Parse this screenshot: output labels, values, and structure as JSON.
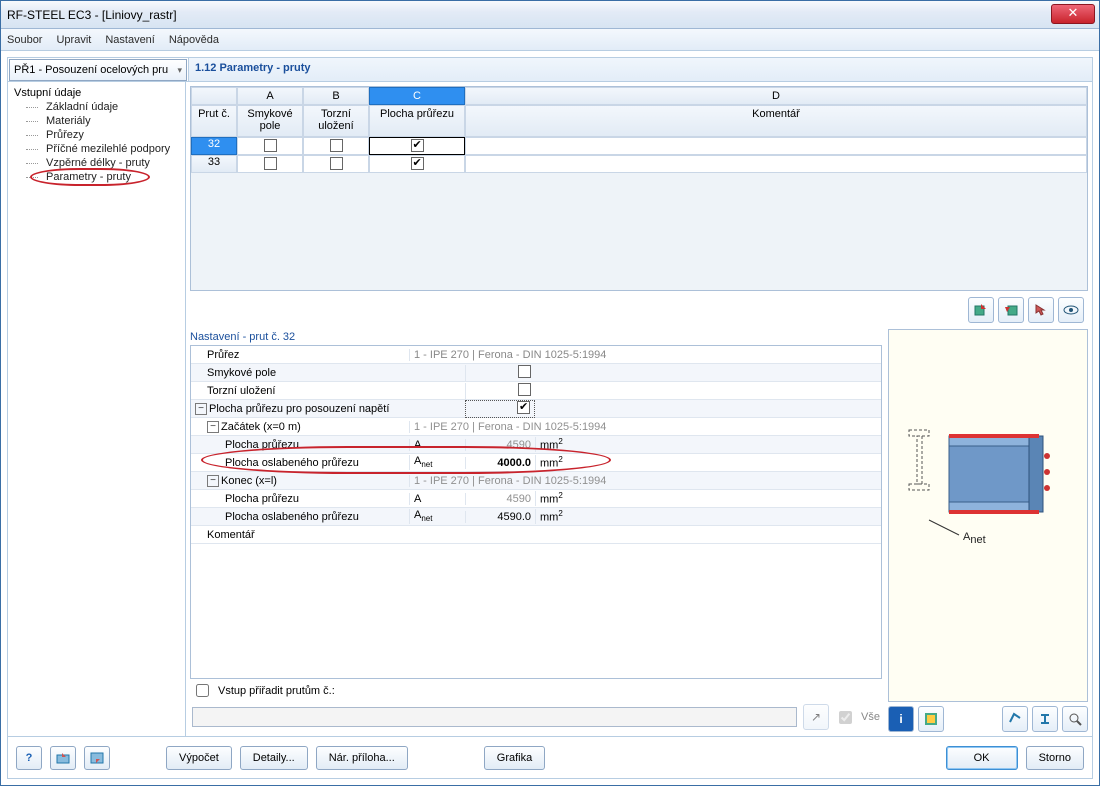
{
  "window": {
    "title": "RF-STEEL EC3 - [Liniovy_rastr]"
  },
  "menu": {
    "file": "Soubor",
    "edit": "Upravit",
    "settings": "Nastavení",
    "help": "Nápověda"
  },
  "combo": {
    "value": "PŘ1 - Posouzení ocelových pru"
  },
  "page_heading": "1.12 Parametry - pruty",
  "tree": {
    "root": "Vstupní údaje",
    "items": [
      "Základní údaje",
      "Materiály",
      "Průřezy",
      "Příčné mezilehlé podpory",
      "Vzpěrné délky - pruty",
      "Parametry - pruty"
    ]
  },
  "grid": {
    "letters": [
      "A",
      "B",
      "C",
      "D"
    ],
    "headers": {
      "rownum": "Prut č.",
      "a": "Smykové pole",
      "b": "Torzní uložení",
      "c": "Plocha průřezu",
      "d": "Komentář"
    },
    "rows": [
      {
        "num": "32",
        "a": false,
        "b": false,
        "c": true,
        "selected": true
      },
      {
        "num": "33",
        "a": false,
        "b": false,
        "c": true,
        "selected": false
      }
    ]
  },
  "toolbar_icons": {
    "i1": "import-icon",
    "i2": "export-icon",
    "i3": "pick-icon",
    "i4": "view-icon"
  },
  "settings": {
    "title": "Nastavení - prut č. 32",
    "section_desc": "1 - IPE 270 | Ferona - DIN 1025-5:1994",
    "rows": {
      "prurez": "Průřez",
      "smykove": "Smykové pole",
      "torzni": "Torzní uložení",
      "plocha_pos": "Plocha průřezu pro posouzení napětí",
      "zacatek": "Začátek (x=0 m)",
      "plocha1": "Plocha průřezu",
      "plocha_osl1": "Plocha oslabeného průřezu",
      "konec": "Konec (x=l)",
      "plocha2": "Plocha průřezu",
      "plocha_osl2": "Plocha oslabeného průřezu",
      "komentar": "Komentář"
    },
    "sym": {
      "A": "A",
      "Anet": "A",
      "Anet_sub": "net"
    },
    "vals": {
      "a1": "4590",
      "anet1": "4000.0",
      "a2": "4590",
      "anet2": "4590.0"
    },
    "unit": "mm",
    "unit_sup": "2"
  },
  "assign": {
    "label": "Vstup přiřadit prutům č.:",
    "all": "Vše"
  },
  "preview_label": "A",
  "preview_sub": "net",
  "preview_tool_icons": {
    "info": "info-icon",
    "layers": "layers-icon",
    "cs1": "cs-icon",
    "cs2": "profile-icon",
    "find": "zoom-icon"
  },
  "footer": {
    "help": "help-icon",
    "load": "load-icon",
    "save": "save-icon",
    "calc": "Výpočet",
    "details": "Detaily...",
    "nat": "Nár. příloha...",
    "graphics": "Grafika",
    "ok": "OK",
    "cancel": "Storno"
  }
}
